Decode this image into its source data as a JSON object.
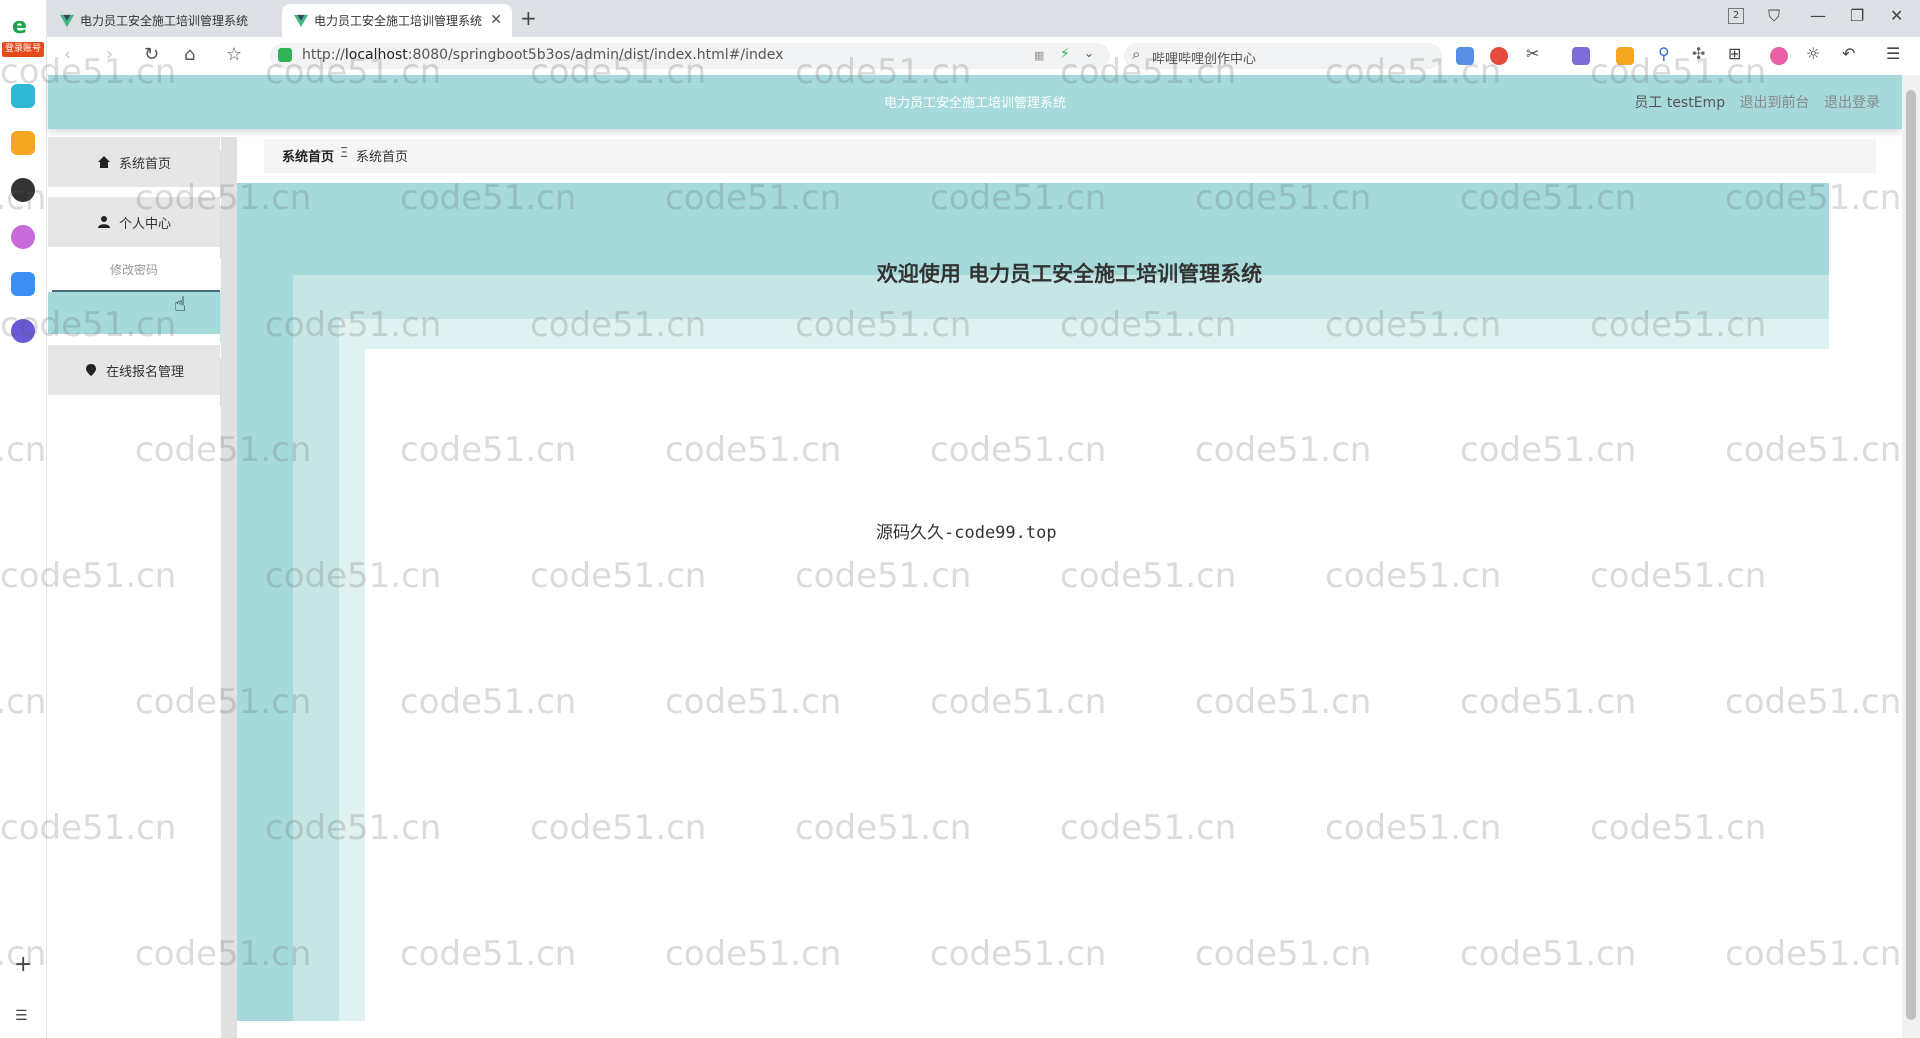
{
  "browser": {
    "tabs": [
      {
        "label": "电力员工安全施工培训管理系统",
        "active": false
      },
      {
        "label": "电力员工安全施工培训管理系统",
        "active": true
      }
    ],
    "url_prefix": "http://",
    "url_host": "localhost",
    "url_rest": ":8080/springboot5b3os/admin/dist/index.html#/index",
    "search_text": "哔哩哔哩创作中心",
    "login_badge": "登录账号",
    "tab_count": "2"
  },
  "app": {
    "title": "电力员工安全施工培训管理系统",
    "user_label": "员工 testEmp",
    "to_front_label": "退出到前台",
    "logout_label": "退出登录",
    "accent_color": "#a6dada"
  },
  "menu": {
    "home": "系统首页",
    "personal": "个人中心",
    "change_password": "修改密码",
    "online_signup": "在线报名管理"
  },
  "breadcrumb": {
    "root": "系统首页",
    "separator": "Ξ",
    "current": "系统首页"
  },
  "main": {
    "welcome": "欢迎使用 电力员工安全施工培训管理系统",
    "footer": "源码久久-code99.top"
  },
  "watermark": "code51.cn"
}
